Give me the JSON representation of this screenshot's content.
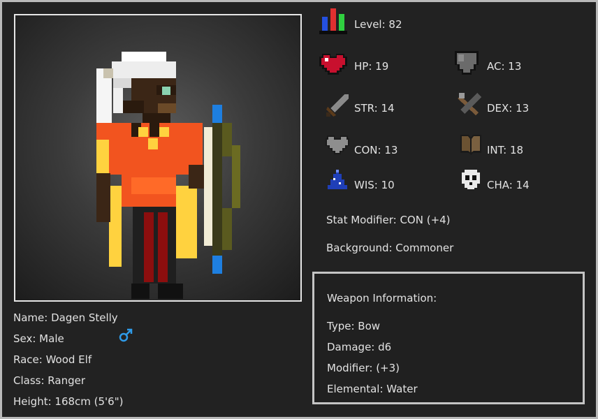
{
  "character": {
    "name": "Name: Dagen Stelly",
    "sex": "Sex: Male",
    "sex_icon": "male-symbol-icon",
    "race": "Race: Wood Elf",
    "class": "Class: Ranger",
    "height": "Height: 168cm (5'6\")"
  },
  "stats": {
    "level": "Level: 82",
    "hp": "HP: 19",
    "ac": "AC: 13",
    "str": "STR: 14",
    "dex": "DEX: 13",
    "con": "CON: 13",
    "int": "INT: 18",
    "wis": "WIS: 10",
    "cha": "CHA: 14"
  },
  "stat_modifier": "Stat Modifier: CON (+4)",
  "background": "Background: Commoner",
  "weapon": {
    "header": "Weapon Information:",
    "type": "Type: Bow",
    "damage": "Damage: d6",
    "modifier": "Modifier: (+3)",
    "elemental": "Elemental: Water"
  },
  "colors": {
    "frame": "#b9b9b9",
    "sex_icon": "#2f9be8",
    "level_bar_red": "#e03030",
    "level_bar_blue": "#2450e0",
    "level_bar_green": "#30d040"
  }
}
